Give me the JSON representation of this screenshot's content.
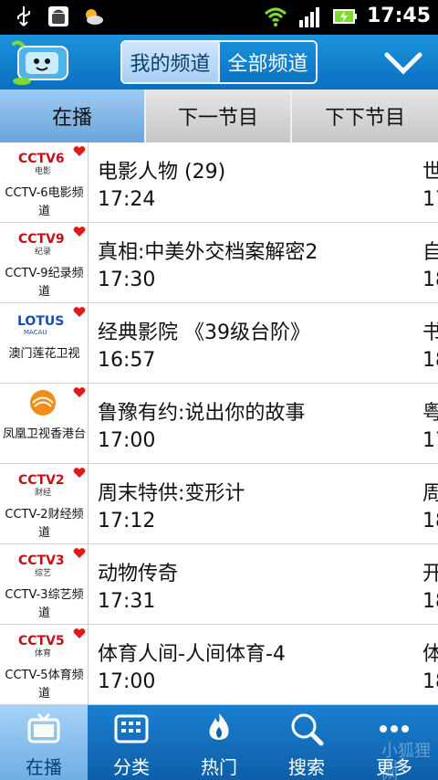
{
  "status_bar": {
    "time": "17:45",
    "icons": [
      "usb-icon",
      "android-icon",
      "weather-icon",
      "wifi-icon",
      "signal-icon",
      "battery-charging-icon"
    ]
  },
  "header": {
    "segments": [
      {
        "label": "我的频道",
        "selected": true
      },
      {
        "label": "全部频道",
        "selected": false
      }
    ],
    "dropdown_icon": "chevron-down-icon"
  },
  "tabs": [
    {
      "label": "在播",
      "selected": true
    },
    {
      "label": "下一节目",
      "selected": false
    },
    {
      "label": "下下节目",
      "selected": false
    }
  ],
  "channels": [
    {
      "name": "CCTV-6电影频道",
      "logo_text": "CCTV6",
      "logo_sub": "电影",
      "program": "电影人物 (29)",
      "time": "17:24",
      "next": "世",
      "next_time": "17"
    },
    {
      "name": "CCTV-9纪录频道",
      "logo_text": "CCTV9",
      "logo_sub": "纪录",
      "program": "真相:中美外交档案解密2",
      "time": "17:30",
      "next": "自",
      "next_time": "18"
    },
    {
      "name": "澳门莲花卫视",
      "logo_text": "LOTUS",
      "logo_sub": "MACAU",
      "program": "经典影院 《39级台阶》",
      "time": "16:57",
      "next": "书",
      "next_time": "18"
    },
    {
      "name": "凤凰卫视香港台",
      "logo_text": "",
      "logo_sub": "",
      "program": "鲁豫有约:说出你的故事",
      "time": "17:00",
      "next": "粤",
      "next_time": "17"
    },
    {
      "name": "CCTV-2财经频道",
      "logo_text": "CCTV2",
      "logo_sub": "财经",
      "program": "周末特供:变形计",
      "time": "17:12",
      "next": "周",
      "next_time": "18"
    },
    {
      "name": "CCTV-3综艺频道",
      "logo_text": "CCTV3",
      "logo_sub": "综艺",
      "program": "动物传奇",
      "time": "17:31",
      "next": "开",
      "next_time": "18"
    },
    {
      "name": "CCTV-5体育频道",
      "logo_text": "CCTV5",
      "logo_sub": "体育",
      "program": "体育人间-人间体育-4",
      "time": "17:00",
      "next": "体",
      "next_time": "18"
    }
  ],
  "bottom_nav": [
    {
      "label": "在播",
      "icon": "tv-icon",
      "selected": true
    },
    {
      "label": "分类",
      "icon": "grid-icon",
      "selected": false
    },
    {
      "label": "热门",
      "icon": "flame-icon",
      "selected": false
    },
    {
      "label": "搜索",
      "icon": "search-icon",
      "selected": false
    },
    {
      "label": "更多",
      "icon": "more-icon",
      "selected": false
    }
  ],
  "watermark": {
    "text": "小狐狸网",
    "sub": "XHL"
  },
  "colors": {
    "brand": "#0a6fc0",
    "active_tab": "#6aa5dc",
    "heart": "#e01818"
  }
}
